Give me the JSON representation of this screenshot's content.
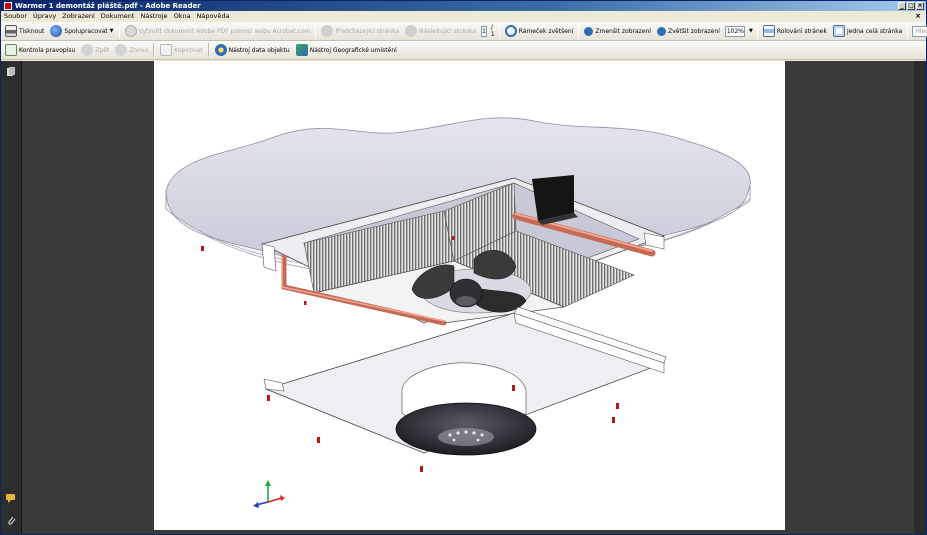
{
  "window": {
    "title": "Warmer 1 demontáž pláště.pdf - Adobe Reader"
  },
  "menu": {
    "items": [
      "Soubor",
      "Úpravy",
      "Zobrazení",
      "Dokument",
      "Nástroje",
      "Okna",
      "Nápověda"
    ],
    "close": "×"
  },
  "toolbar1": {
    "print": "Tisknout",
    "collaborate": "Spolupracovat",
    "create_pdf": "Vytvořit dokument Adobe PDF pomocí webu Acrobat.com",
    "prev_page": "Předcházející stránka",
    "next_page": "Následující stránka",
    "page_current": "1",
    "page_total": "/ 1",
    "marquee_zoom": "Rámeček zvětšení",
    "zoom_out": "Zmenšit zobrazení",
    "zoom_in": "Zvětšit zobrazení",
    "zoom_value": "102%",
    "scroll_pages": "Rolování stránek",
    "single_page": "Jedna celá stránka",
    "find_placeholder": "Hledat"
  },
  "toolbar2": {
    "spellcheck": "Kontrola pravopisu",
    "back": "Zpět",
    "forward": "Znovu",
    "copy": "Kopírovat",
    "object_data_tool": "Nástroj data objektu",
    "geo_tool": "Nástroj Geografické umístění"
  },
  "colors": {
    "title_bar": "#0a246a",
    "doc_background": "#3a3a3a",
    "page": "#ffffff",
    "copper": "#d9826b",
    "ceiling": "#d4d6e2"
  },
  "icons": [
    "printer-icon",
    "collaborate-icon",
    "create-pdf-icon",
    "prev-page-icon",
    "next-page-icon",
    "marquee-zoom-icon",
    "zoom-out-icon",
    "zoom-in-icon",
    "scroll-icon",
    "fit-page-icon",
    "spellcheck-icon",
    "back-icon",
    "forward-icon",
    "copy-icon",
    "object-data-icon",
    "geo-icon",
    "pages-panel-icon",
    "comments-icon",
    "attachment-icon"
  ]
}
